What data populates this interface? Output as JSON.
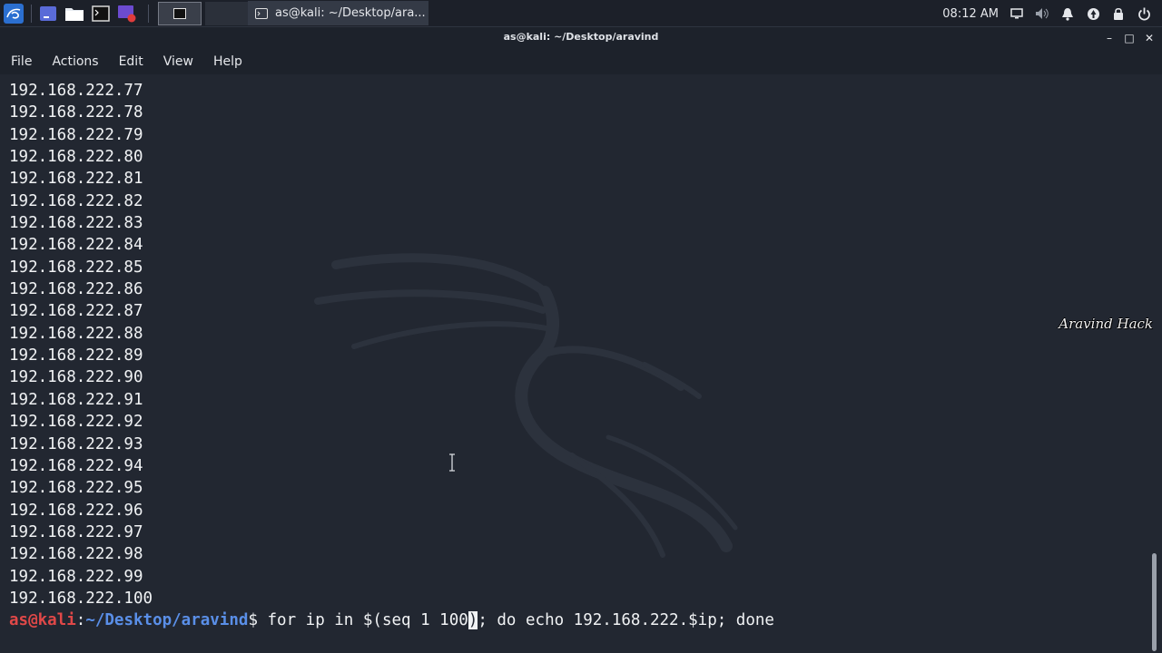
{
  "taskbar": {
    "launchers": [
      "terminal-launcher",
      "file-manager-launcher",
      "terminal-emulator-launcher",
      "screen-recorder-launcher"
    ],
    "workspaces": [
      "1",
      "2"
    ],
    "task": {
      "label": "as@kali: ~/Desktop/ara..."
    },
    "clock": "08:12 AM",
    "tray": [
      "screen-icon",
      "volume-icon",
      "bell-icon",
      "network-icon",
      "lock-icon",
      "power-icon"
    ]
  },
  "window": {
    "title": "as@kali: ~/Desktop/aravind",
    "controls": {
      "minimize": "–",
      "maximize": "□",
      "close": "✕"
    }
  },
  "menu": {
    "file": "File",
    "actions": "Actions",
    "edit": "Edit",
    "view": "View",
    "help": "Help"
  },
  "terminal": {
    "output_lines": [
      "192.168.222.77",
      "192.168.222.78",
      "192.168.222.79",
      "192.168.222.80",
      "192.168.222.81",
      "192.168.222.82",
      "192.168.222.83",
      "192.168.222.84",
      "192.168.222.85",
      "192.168.222.86",
      "192.168.222.87",
      "192.168.222.88",
      "192.168.222.89",
      "192.168.222.90",
      "192.168.222.91",
      "192.168.222.92",
      "192.168.222.93",
      "192.168.222.94",
      "192.168.222.95",
      "192.168.222.96",
      "192.168.222.97",
      "192.168.222.98",
      "192.168.222.99",
      "192.168.222.100"
    ],
    "prompt": {
      "user_host": "as@kali",
      "colon": ":",
      "path": "~/Desktop/aravind",
      "symbol": "$"
    },
    "command_before_cursor": " for ip in $(seq 1 100",
    "cursor_char": ")",
    "command_after_cursor": "; do echo 192.168.222.$ip; done",
    "watermark_signature": "Aravind Hack"
  },
  "colors": {
    "background": "#222731",
    "prompt_user": "#e04848",
    "prompt_path": "#5a8fe8",
    "text": "#f0f2f4"
  }
}
